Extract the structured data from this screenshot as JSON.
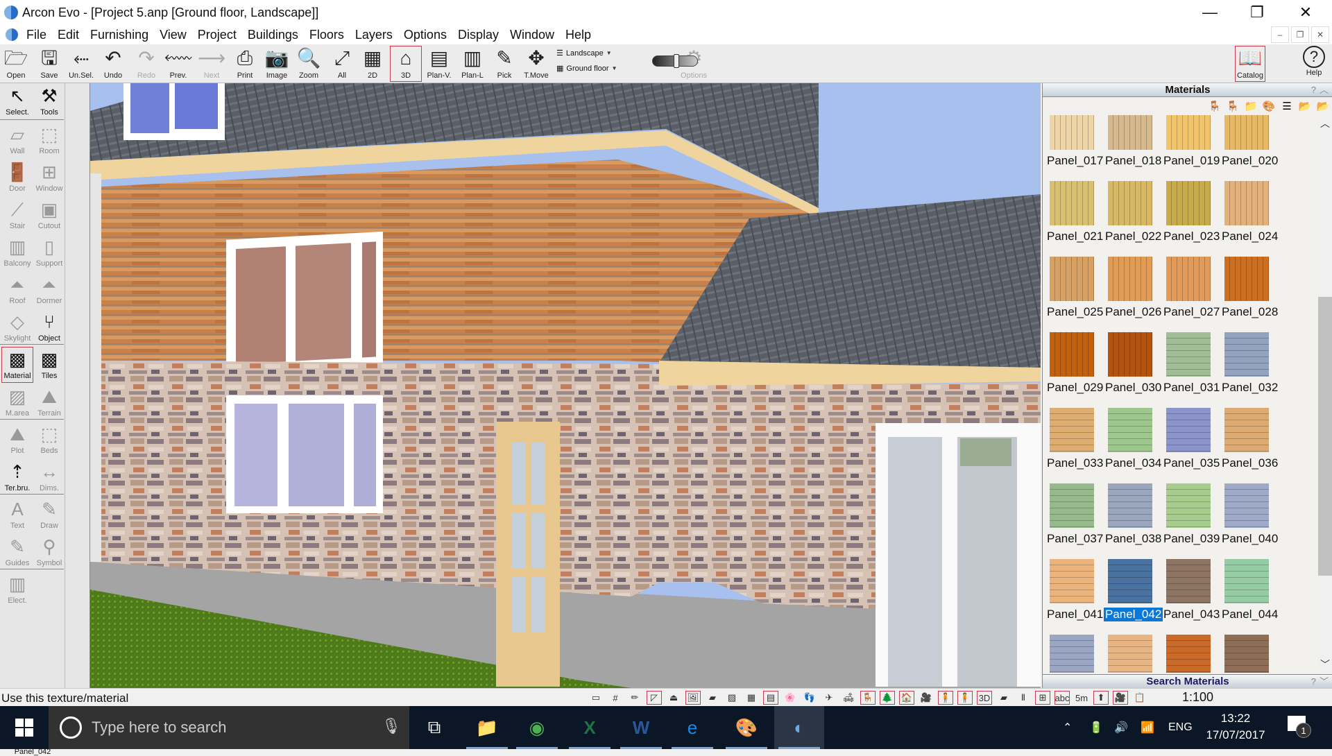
{
  "window": {
    "title": "Arcon Evo - [Project 5.anp [Ground floor, Landscape]]",
    "controls": {
      "minimize": "—",
      "restore": "❐",
      "close": "✕"
    },
    "mdi_controls": {
      "minimize": "–",
      "restore": "❐",
      "close": "✕"
    }
  },
  "menu": [
    "File",
    "Edit",
    "Furnishing",
    "View",
    "Project",
    "Buildings",
    "Floors",
    "Layers",
    "Options",
    "Display",
    "Window",
    "Help"
  ],
  "toolbar": {
    "buttons": [
      {
        "id": "open",
        "label": "Open",
        "icon": "🗁",
        "enabled": true
      },
      {
        "id": "save",
        "label": "Save",
        "icon": "🖫",
        "enabled": true
      },
      {
        "id": "unsel",
        "label": "Un.Sel.",
        "icon": "⬸",
        "enabled": true
      },
      {
        "id": "undo",
        "label": "Undo",
        "icon": "↶",
        "enabled": true
      },
      {
        "id": "redo",
        "label": "Redo",
        "icon": "↷",
        "enabled": false
      },
      {
        "id": "prev",
        "label": "Prev.",
        "icon": "⬳",
        "enabled": true
      },
      {
        "id": "next",
        "label": "Next",
        "icon": "⟶",
        "enabled": false
      },
      {
        "id": "print",
        "label": "Print",
        "icon": "⎙",
        "enabled": true
      },
      {
        "id": "image",
        "label": "Image",
        "icon": "📷",
        "enabled": true
      },
      {
        "id": "zoom",
        "label": "Zoom",
        "icon": "🔍",
        "enabled": true
      },
      {
        "id": "all",
        "label": "All",
        "icon": "⤢",
        "enabled": true
      },
      {
        "id": "2d",
        "label": "2D",
        "icon": "▦",
        "enabled": true
      },
      {
        "id": "3d",
        "label": "3D",
        "icon": "⌂",
        "enabled": true,
        "active": true
      },
      {
        "id": "planv",
        "label": "Plan-V.",
        "icon": "▤",
        "enabled": true
      },
      {
        "id": "planl",
        "label": "Plan-L",
        "icon": "▥",
        "enabled": true
      },
      {
        "id": "pick",
        "label": "Pick",
        "icon": "✎",
        "enabled": true
      },
      {
        "id": "tmove",
        "label": "T.Move",
        "icon": "✥",
        "enabled": true
      }
    ],
    "layer_dropdown": "Landscape",
    "floor_dropdown": "Ground floor",
    "options_label": "Options",
    "catalog_label": "Catalog",
    "help_label": "Help"
  },
  "palette": {
    "items": [
      {
        "label": "Select.",
        "icon": "↖",
        "on": true
      },
      {
        "label": "Tools",
        "icon": "⚒",
        "on": true
      },
      {
        "label": "Wall",
        "icon": "▱",
        "on": false
      },
      {
        "label": "Room",
        "icon": "⬚",
        "on": false
      },
      {
        "label": "Door",
        "icon": "🚪",
        "on": false
      },
      {
        "label": "Window",
        "icon": "⊞",
        "on": false
      },
      {
        "label": "Stair",
        "icon": "⟋",
        "on": false
      },
      {
        "label": "Cutout",
        "icon": "▣",
        "on": false
      },
      {
        "label": "Balcony",
        "icon": "▥",
        "on": false
      },
      {
        "label": "Support",
        "icon": "▯",
        "on": false
      },
      {
        "label": "Roof",
        "icon": "⏶",
        "on": false
      },
      {
        "label": "Dormer",
        "icon": "⏶",
        "on": false
      },
      {
        "label": "Skylight",
        "icon": "◇",
        "on": false
      },
      {
        "label": "Object",
        "icon": "⑂",
        "on": true
      },
      {
        "label": "Material",
        "icon": "▩",
        "on": true,
        "selected": true
      },
      {
        "label": "Tiles",
        "icon": "▩",
        "on": true
      },
      {
        "label": "M.area",
        "icon": "▨",
        "on": false
      },
      {
        "label": "Terrain",
        "icon": "⛰",
        "on": false
      },
      {
        "label": "Plot",
        "icon": "⛰",
        "on": false
      },
      {
        "label": "Beds",
        "icon": "⬚",
        "on": false
      },
      {
        "label": "Ter.bru.",
        "icon": "⇡",
        "on": true
      },
      {
        "label": "Dims.",
        "icon": "↔",
        "on": false
      },
      {
        "label": "Text",
        "icon": "A",
        "on": false
      },
      {
        "label": "Draw",
        "icon": "✎",
        "on": false
      },
      {
        "label": "Guides",
        "icon": "✎",
        "on": false
      },
      {
        "label": "Symbol",
        "icon": "⚲",
        "on": false
      },
      {
        "label": "Elect.",
        "icon": "▥",
        "on": false
      }
    ],
    "current_material": "Panel_042"
  },
  "materials_panel": {
    "title": "Materials",
    "help": "?",
    "collapse": "︿",
    "tool_icons": [
      "🪑",
      "🪑",
      "📁",
      "🎨",
      "☰",
      "📂",
      "📂"
    ],
    "items": [
      {
        "name": "Panel_017",
        "color": "#efd4a6",
        "dir": "v"
      },
      {
        "name": "Panel_018",
        "color": "#d7b98e",
        "dir": "v"
      },
      {
        "name": "Panel_019",
        "color": "#f2c46a",
        "dir": "v"
      },
      {
        "name": "Panel_020",
        "color": "#e8b862",
        "dir": "v"
      },
      {
        "name": "Panel_021",
        "color": "#d8c06e",
        "dir": "v"
      },
      {
        "name": "Panel_022",
        "color": "#d9b862",
        "dir": "v"
      },
      {
        "name": "Panel_023",
        "color": "#c8aa48",
        "dir": "v"
      },
      {
        "name": "Panel_024",
        "color": "#e4b07a",
        "dir": "v"
      },
      {
        "name": "Panel_025",
        "color": "#d8a062",
        "dir": "v"
      },
      {
        "name": "Panel_026",
        "color": "#e39a52",
        "dir": "v"
      },
      {
        "name": "Panel_027",
        "color": "#e39a58",
        "dir": "v"
      },
      {
        "name": "Panel_028",
        "color": "#cf6e1e",
        "dir": "v"
      },
      {
        "name": "Panel_029",
        "color": "#c2620e",
        "dir": "v"
      },
      {
        "name": "Panel_030",
        "color": "#b4520e",
        "dir": "v"
      },
      {
        "name": "Panel_031",
        "color": "#9fbe96",
        "dir": "h"
      },
      {
        "name": "Panel_032",
        "color": "#94a3bd",
        "dir": "h"
      },
      {
        "name": "Panel_033",
        "color": "#dcae72",
        "dir": "h"
      },
      {
        "name": "Panel_034",
        "color": "#9ec78e",
        "dir": "h"
      },
      {
        "name": "Panel_035",
        "color": "#8c94cc",
        "dir": "h"
      },
      {
        "name": "Panel_036",
        "color": "#dcaa72",
        "dir": "h"
      },
      {
        "name": "Panel_037",
        "color": "#96ba8c",
        "dir": "h"
      },
      {
        "name": "Panel_038",
        "color": "#9aa6bc",
        "dir": "h"
      },
      {
        "name": "Panel_039",
        "color": "#a6cc8e",
        "dir": "h"
      },
      {
        "name": "Panel_040",
        "color": "#9eaac6",
        "dir": "h"
      },
      {
        "name": "Panel_041",
        "color": "#eab47c",
        "dir": "h"
      },
      {
        "name": "Panel_042",
        "color": "#4a72a0",
        "dir": "h",
        "selected": true
      },
      {
        "name": "Panel_043",
        "color": "#8e7462",
        "dir": "h"
      },
      {
        "name": "Panel_044",
        "color": "#96cca4",
        "dir": "h"
      },
      {
        "name": "",
        "color": "#9aa6c2",
        "dir": "h"
      },
      {
        "name": "",
        "color": "#e8b684",
        "dir": "h"
      },
      {
        "name": "",
        "color": "#c96a28",
        "dir": "h"
      },
      {
        "name": "",
        "color": "#8e6e56",
        "dir": "h"
      }
    ],
    "scroll_up": "︿",
    "scroll_down": "﹀",
    "search_title": "Search Materials"
  },
  "statusbar": {
    "message": "Use this texture/material",
    "icons": [
      "▭",
      "#",
      "✏",
      "◸",
      "⏏",
      "🖼",
      "▰",
      "▨",
      "▦",
      "▤",
      "🌸",
      "👣",
      "✈",
      "🛋",
      "🪑",
      "🌲",
      "🏠",
      "🎥",
      "🧍",
      "🧍",
      "3D",
      "▰",
      "Ⅱ",
      "⊞",
      "abc",
      "5m",
      "⬆",
      "🎥",
      "📋"
    ],
    "boxed": [
      3,
      5,
      9,
      14,
      15,
      16,
      18,
      19,
      20,
      23,
      24,
      26,
      27
    ],
    "scale": "1:100"
  },
  "taskbar": {
    "search_placeholder": "Type here to search",
    "apps": [
      {
        "name": "task-view",
        "icon": "⧉"
      },
      {
        "name": "file-explorer",
        "icon": "📁"
      },
      {
        "name": "chrome",
        "icon": "◉"
      },
      {
        "name": "excel",
        "icon": "X"
      },
      {
        "name": "word",
        "icon": "W"
      },
      {
        "name": "edge",
        "icon": "e"
      },
      {
        "name": "paint",
        "icon": "🎨"
      },
      {
        "name": "arcon",
        "icon": "◐"
      }
    ],
    "tray": {
      "chevron": "⌃",
      "battery": "🔋",
      "volume": "🔊",
      "wifi": "📶",
      "lang": "ENG"
    },
    "time": "13:22",
    "date": "17/07/2017",
    "notifications": "1"
  }
}
